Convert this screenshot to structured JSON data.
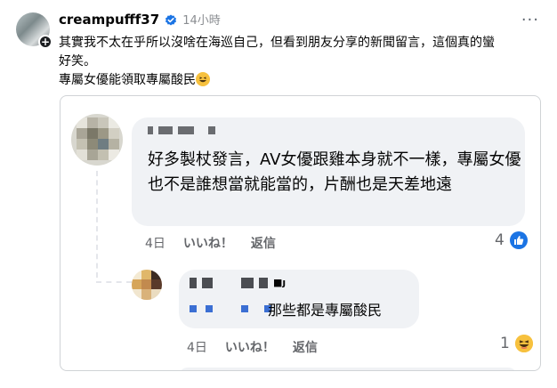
{
  "post": {
    "username": "creampufff37",
    "timestamp": "14小時",
    "more_label": "···",
    "text_line1": "其實我不太在乎所以沒啥在海巡自己，但看到朋友分享的新聞留言，這個真的蠻",
    "text_line2": "好笑。",
    "text_line3": "專屬女優能領取專屬酸民"
  },
  "embedded": {
    "comment1": {
      "text": "好多製杖發言，AV女優跟雞本身就不一樣，專屬女優也不是誰想當就能當的，片酬也是天差地遠",
      "time": "4日",
      "like_label": "いいね！",
      "reply_label": "返信",
      "reaction_count": "4"
    },
    "comment2": {
      "name_suffix": "■ȷ",
      "text": "那些都是專屬酸民",
      "time": "4日",
      "like_label": "いいね！",
      "reply_label": "返信",
      "reaction_count": "1"
    }
  },
  "colors": {
    "like": "#1b74e4",
    "haha": "#f7c13e",
    "bubble": "#f0f2f5",
    "verified": "#1b74e4"
  },
  "icons": [
    "verified-badge-icon",
    "follow-plus-icon",
    "more-options-icon",
    "grinning-emoji-icon",
    "like-reaction-icon",
    "haha-reaction-icon"
  ]
}
